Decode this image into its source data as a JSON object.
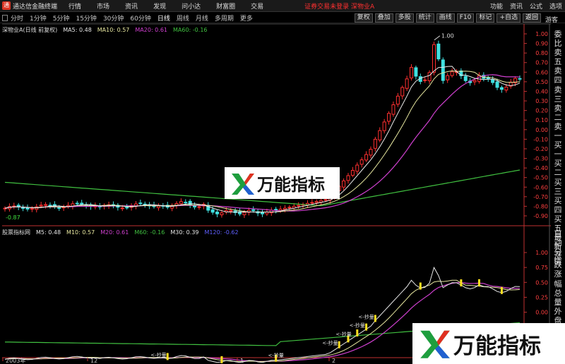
{
  "app": {
    "title": "通达信金融终端",
    "guest": "游客"
  },
  "menu": [
    "行情",
    "市场",
    "资讯",
    "发现",
    "问小达",
    "财富圈",
    "交易"
  ],
  "notice": "证券交易未登录  深物业A",
  "menu_right": [
    "功能",
    "资讯",
    "公式",
    "选项"
  ],
  "periods": [
    {
      "label": "分时",
      "active": false
    },
    {
      "label": "1分钟",
      "active": false
    },
    {
      "label": "5分钟",
      "active": false
    },
    {
      "label": "15分钟",
      "active": false
    },
    {
      "label": "30分钟",
      "active": false
    },
    {
      "label": "60分钟",
      "active": false
    },
    {
      "label": "日线",
      "active": true
    },
    {
      "label": "周线",
      "active": false
    },
    {
      "label": "月线",
      "active": false
    },
    {
      "label": "多周期",
      "active": false
    },
    {
      "label": "更多",
      "active": false
    }
  ],
  "toolbar_right": [
    "复权",
    "叠加",
    "多股",
    "统计",
    "画线",
    "F10",
    "标记",
    "+自选",
    "返回"
  ],
  "main_legend": {
    "name": "深物业A(日线 前复权)",
    "items": [
      {
        "label": "MA5: 0.48",
        "color": "#e8e8e8"
      },
      {
        "label": "MA10: 0.57",
        "color": "#e8e8a0"
      },
      {
        "label": "MA20: 0.61",
        "color": "#d040d0"
      },
      {
        "label": "MA60: -0.16",
        "color": "#40c040"
      }
    ]
  },
  "sub_legend": {
    "name": "股票指标网",
    "items": [
      {
        "label": "M5: 0.48",
        "color": "#e8e8e8"
      },
      {
        "label": "M10: 0.57",
        "color": "#e8e8a0"
      },
      {
        "label": "M20: 0.61",
        "color": "#d040d0"
      },
      {
        "label": "M60: -0.16",
        "color": "#40c040"
      },
      {
        "label": "M30: 0.39",
        "color": "#e8e8e8"
      },
      {
        "label": "M120: -0.62",
        "color": "#6060ff"
      }
    ]
  },
  "side_panel": [
    "委比",
    "卖五",
    "卖四",
    "卖三",
    "卖二",
    "卖一",
    "买一",
    "买二",
    "买三",
    "买四",
    "买五",
    "最新",
    "涨跌",
    "涨幅",
    "总量",
    "外盘",
    "换手",
    "净资",
    "收益"
  ],
  "side_panel_bottom": [
    "自动",
    "分情"
  ],
  "main_axis": [
    "1.00",
    "0.90",
    "0.80",
    "0.70",
    "0.60",
    "0.50",
    "0.40",
    "0.30",
    "0.20",
    "0.10",
    "0.00",
    "-0.10",
    "-0.20",
    "-0.30",
    "-0.40",
    "-0.50",
    "-0.60",
    "-0.70",
    "-0.80",
    "-0.90"
  ],
  "sub_axis": [
    "1.00",
    "0.75",
    "0.50",
    "0.25",
    "0.00",
    "-0.25",
    "-0.50",
    "-0.75"
  ],
  "annotations": {
    "high": "1.00",
    "low": "-0.87"
  },
  "signal_label": "<-抄量",
  "date_labels": [
    "2003年",
    "12",
    "1",
    "2"
  ],
  "watermark": "万能指标",
  "colors": {
    "up": "#ff3030",
    "down": "#40e0e0",
    "grid": "#7a1010",
    "axis": "#c03030"
  }
}
